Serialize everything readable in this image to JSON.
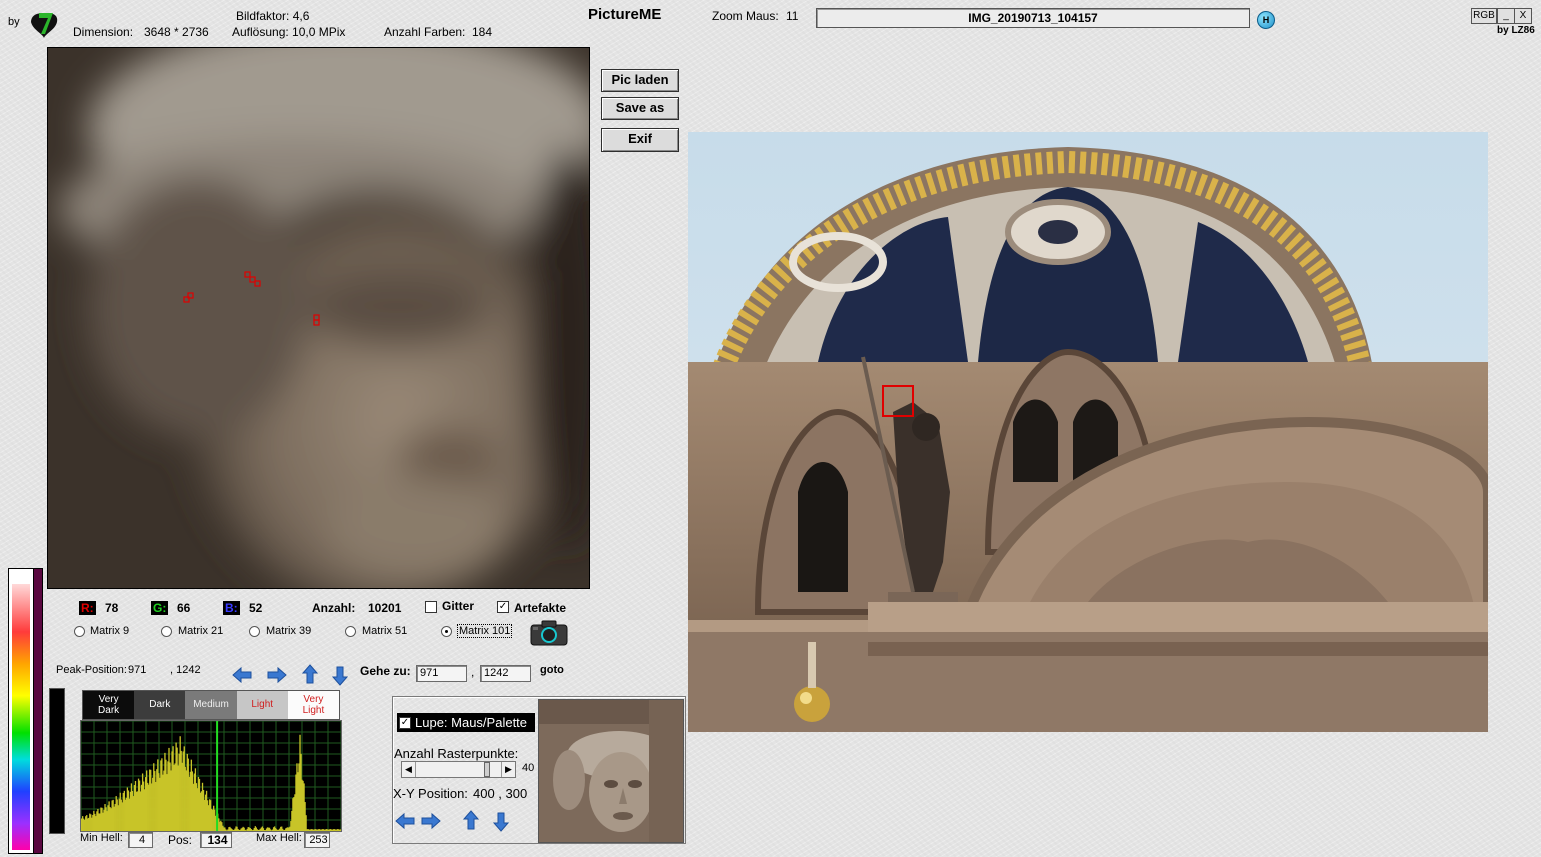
{
  "header": {
    "by_label": "by",
    "bildfaktor": "Bildfaktor: 4,6",
    "dimension_label": "Dimension:",
    "dimension_value": "3648 * 2736",
    "aufloesung": "Auflösung: 10,0 MPix",
    "farben_label": "Anzahl Farben:",
    "farben_value": "184",
    "app_title": "PictureME",
    "zoom_label": "Zoom Maus:",
    "zoom_value": "11",
    "filename": "IMG_20190713_104157",
    "help_glyph": "H",
    "rgb_button": "RGB",
    "minimize_button": "_",
    "close_button": "X",
    "credit": "by LZ86"
  },
  "buttons": {
    "load": "Pic laden",
    "save": "Save as",
    "exif": "Exif"
  },
  "pixel": {
    "r_label": "R:",
    "r_value": "78",
    "g_label": "G:",
    "g_value": "66",
    "b_label": "B:",
    "b_value": "52",
    "anzahl_label": "Anzahl:",
    "anzahl_value": "10201",
    "gitter_label": "Gitter",
    "gitter_checked": false,
    "artefakte_label": "Artefakte",
    "artefakte_checked": true
  },
  "matrix_options": [
    {
      "label": "Matrix 9",
      "selected": false
    },
    {
      "label": "Matrix 21",
      "selected": false
    },
    {
      "label": "Matrix 39",
      "selected": false
    },
    {
      "label": "Matrix 51",
      "selected": false
    },
    {
      "label": "Matrix 101",
      "selected": true
    }
  ],
  "peak": {
    "label": "Peak-Position:",
    "x": "971",
    "y": ", 1242"
  },
  "goto": {
    "label": "Gehe zu:",
    "x": "971",
    "sep": ",",
    "y": "1242",
    "button": "goto"
  },
  "histogram": {
    "bands": [
      {
        "label": "Very\nDark"
      },
      {
        "label": "Dark"
      },
      {
        "label": "Medium"
      },
      {
        "label": "Light"
      },
      {
        "label": "Very\nLight"
      }
    ],
    "min_label": "Min Hell:",
    "min_value": "4",
    "pos_label": "Pos:",
    "pos_value": "134",
    "max_label": "Max Hell:",
    "max_value": "253",
    "bar_color": "#c8c428",
    "marker_color": "#22dd22",
    "grid_color": "#1f5a1f"
  },
  "lupe": {
    "checkbox_label": "Lupe: Maus/Palette",
    "checked": true,
    "raster_label": "Anzahl Rasterpunkte:",
    "raster_value": "40",
    "raster_level": 0.85,
    "xy_label": "X-Y Position:",
    "xy_value": "400 , 300"
  },
  "colors": {
    "accent_red": "#cc0000",
    "accent_green": "#00aa00",
    "accent_blue": "#0000cc",
    "arrow_blue": "#3a78d0"
  }
}
